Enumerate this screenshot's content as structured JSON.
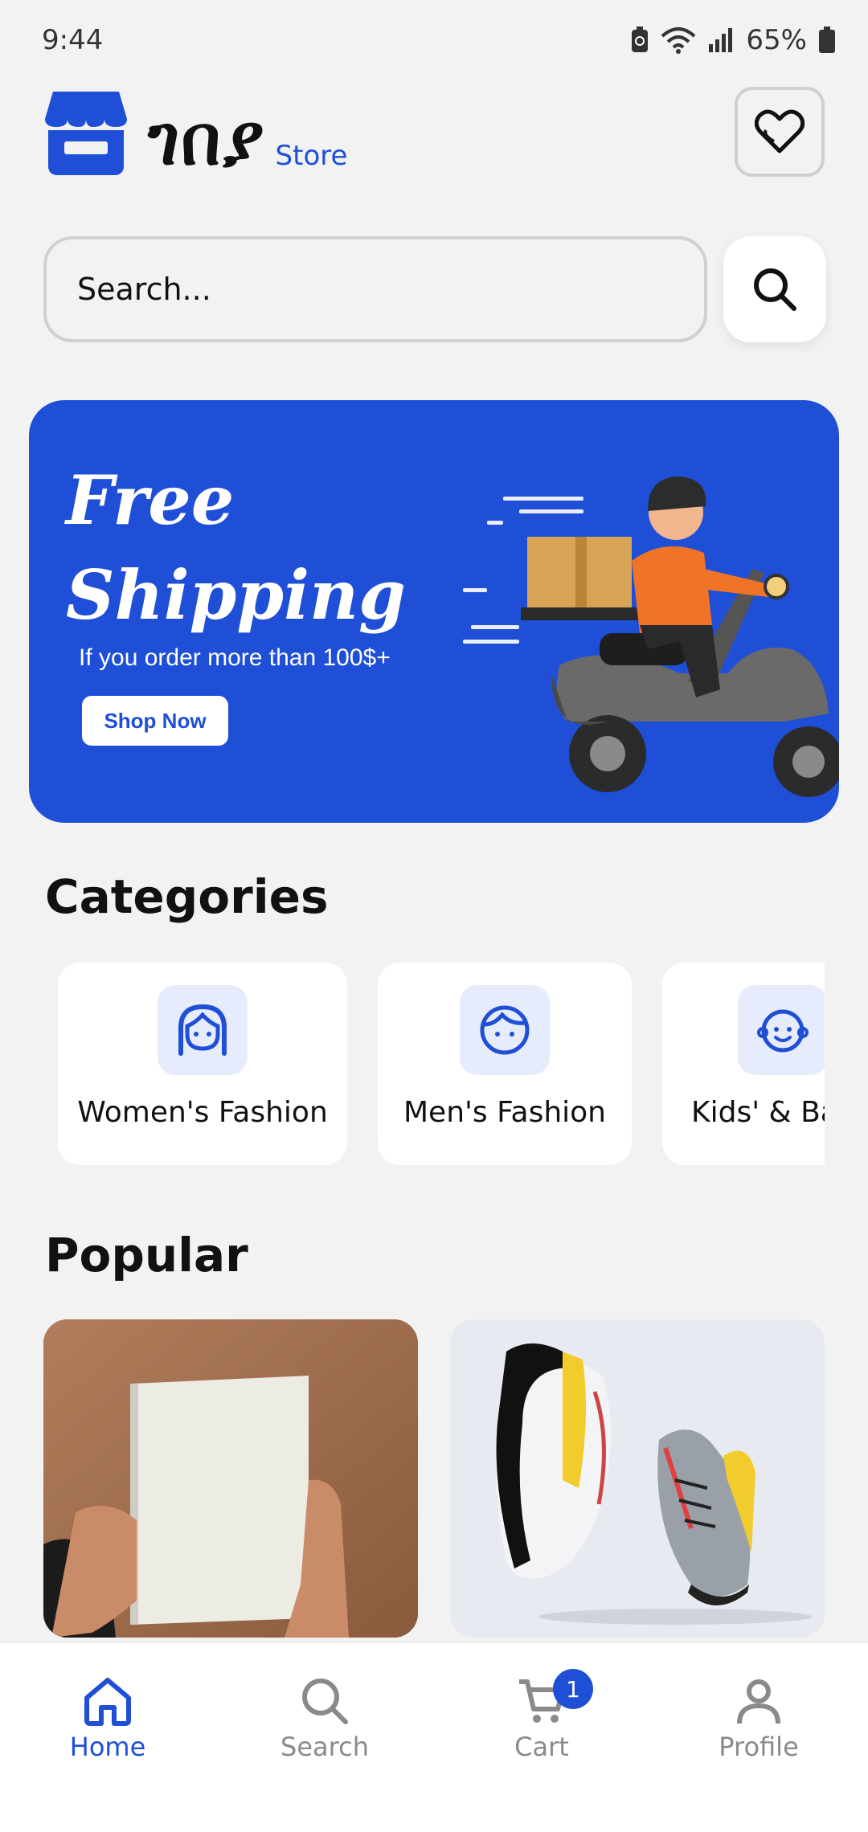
{
  "status_bar": {
    "time": "9:44",
    "battery": "65%"
  },
  "header": {
    "logo_text": "ገበያ",
    "logo_sub": "Store"
  },
  "search": {
    "placeholder": "Search..."
  },
  "banner": {
    "title_line1": "Free",
    "title_line2": "Shipping",
    "subtitle": "If you order more than 100$+",
    "button": "Shop Now"
  },
  "categories": {
    "title": "Categories",
    "items": [
      {
        "label": "Women's Fashion",
        "icon": "woman-face-icon"
      },
      {
        "label": "Men's Fashion",
        "icon": "man-face-icon"
      },
      {
        "label": "Kids' & Baby",
        "icon": "baby-face-icon"
      }
    ]
  },
  "popular": {
    "title": "Popular",
    "items": [
      {
        "image": "book-held-in-hands"
      },
      {
        "image": "pair-of-running-shoes"
      }
    ]
  },
  "bottom_nav": {
    "items": [
      {
        "label": "Home",
        "icon": "home-icon",
        "active": true
      },
      {
        "label": "Search",
        "icon": "search-icon",
        "active": false
      },
      {
        "label": "Cart",
        "icon": "cart-icon",
        "active": false,
        "badge": "1"
      },
      {
        "label": "Profile",
        "icon": "profile-icon",
        "active": false
      }
    ]
  },
  "colors": {
    "accent": "#1f4fd6",
    "background": "#f2f2f2",
    "card": "#ffffff"
  }
}
